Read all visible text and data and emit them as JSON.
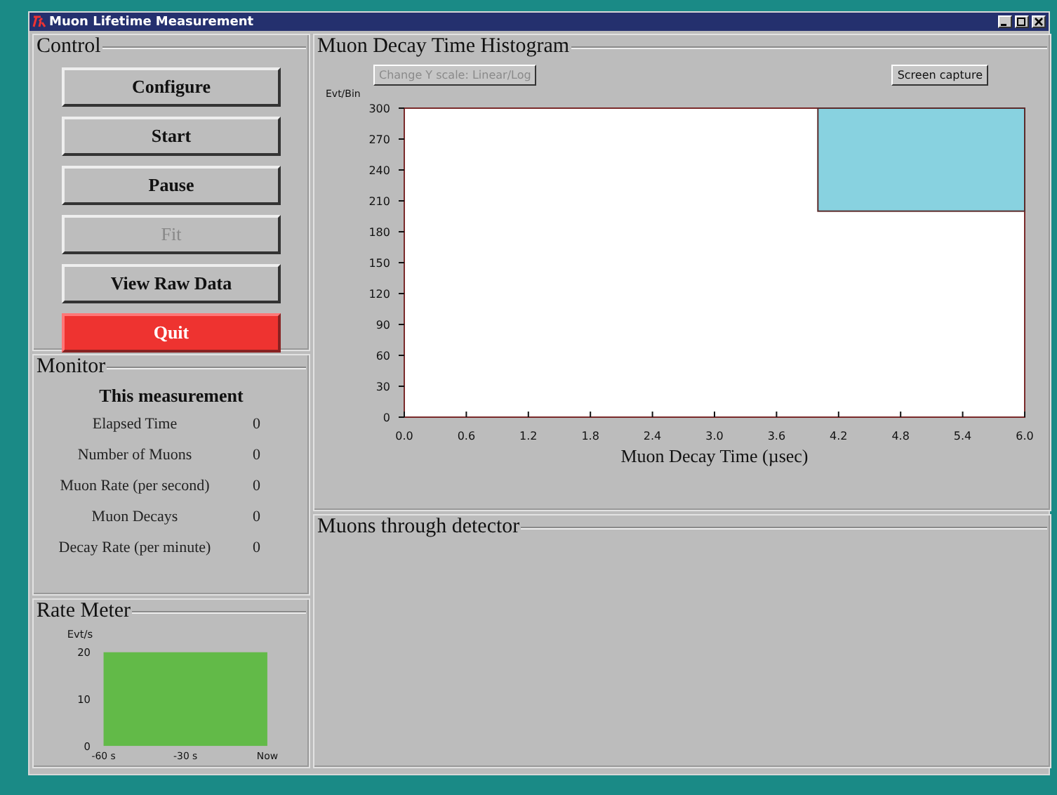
{
  "window": {
    "title": "Muon Lifetime Measurement"
  },
  "control": {
    "title": "Control",
    "buttons": [
      {
        "label": "Configure",
        "kind": "normal",
        "disabled": false
      },
      {
        "label": "Start",
        "kind": "normal",
        "disabled": false
      },
      {
        "label": "Pause",
        "kind": "normal",
        "disabled": false
      },
      {
        "label": "Fit",
        "kind": "normal",
        "disabled": true
      },
      {
        "label": "View Raw Data",
        "kind": "normal",
        "disabled": false
      },
      {
        "label": "Quit",
        "kind": "danger",
        "disabled": false
      }
    ]
  },
  "monitor": {
    "title": "Monitor",
    "heading": "This measurement",
    "rows": [
      {
        "label": "Elapsed Time",
        "value": "0"
      },
      {
        "label": "Number of Muons",
        "value": "0"
      },
      {
        "label": "Muon Rate (per second)",
        "value": "0"
      },
      {
        "label": "Muon Decays",
        "value": "0"
      },
      {
        "label": "Decay Rate (per minute)",
        "value": "0"
      }
    ]
  },
  "rate_meter": {
    "title": "Rate Meter",
    "ylabel": "Evt/s",
    "y_tick_labels": [
      "20",
      "10",
      "0"
    ],
    "x_tick_labels": [
      "-60 s",
      "-30 s",
      "Now"
    ]
  },
  "histogram": {
    "title": "Muon Decay Time Histogram",
    "scale_button": {
      "label": "Change Y scale: Linear/Log",
      "disabled": true
    },
    "capture_button": {
      "label": "Screen capture",
      "disabled": false
    },
    "chart_data": {
      "type": "bar",
      "xlabel": "Muon Decay Time (µsec)",
      "ylabel": "Evt/Bin",
      "xlim": [
        0,
        6
      ],
      "ylim": [
        0,
        300
      ],
      "xticks": [
        {
          "value": 0,
          "label": "0.0"
        },
        {
          "value": 0.6,
          "label": "0.6"
        },
        {
          "value": 1.2,
          "label": "1.2"
        },
        {
          "value": 1.8,
          "label": "1.8"
        },
        {
          "value": 2.4,
          "label": "2.4"
        },
        {
          "value": 3,
          "label": "3.0"
        },
        {
          "value": 3.6,
          "label": "3.6"
        },
        {
          "value": 4.2,
          "label": "4.2"
        },
        {
          "value": 4.8,
          "label": "4.8"
        },
        {
          "value": 5.4,
          "label": "5.4"
        },
        {
          "value": 6,
          "label": "6.0"
        }
      ],
      "yticks": [
        0,
        30,
        60,
        90,
        120,
        150,
        180,
        210,
        240,
        270,
        300
      ]
    }
  },
  "detector": {
    "title": "Muons through detector"
  }
}
